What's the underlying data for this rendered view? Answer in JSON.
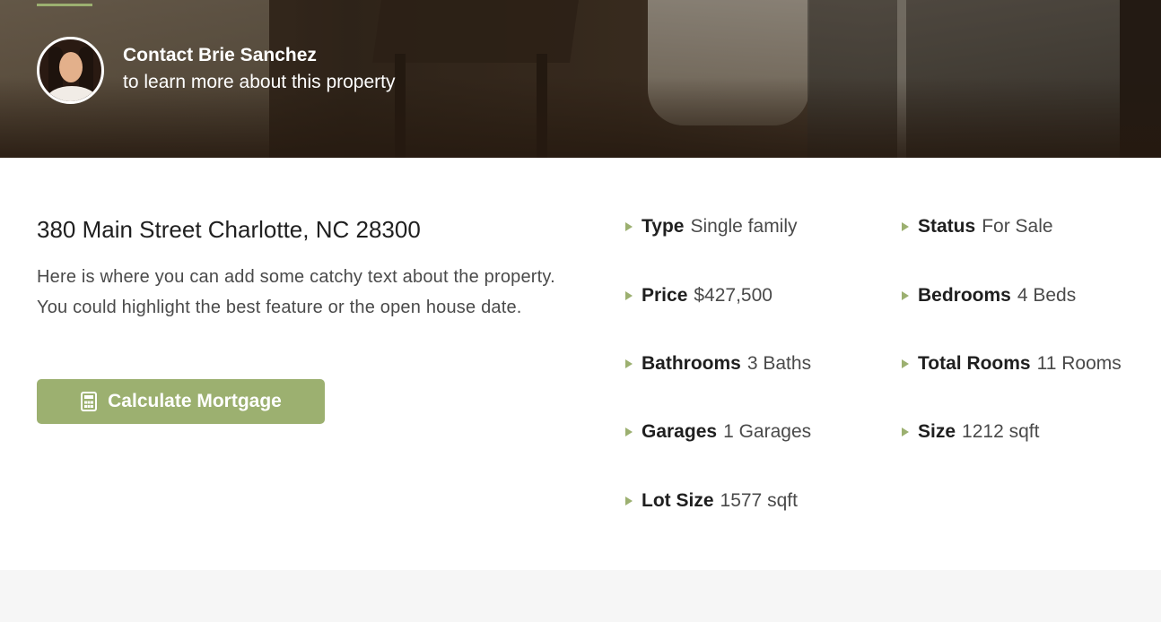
{
  "contact": {
    "name": "Contact Brie Sanchez",
    "subtitle": "to learn more about this property"
  },
  "property": {
    "address": "380 Main Street Charlotte, NC 28300",
    "description": "Here is where you can add some catchy text about the property. You could highlight the best feature or the open house date.",
    "mortgage_button": "Calculate Mortgage",
    "mortgage_icon": "calculator-icon",
    "features": [
      {
        "label": "Type",
        "value": "Single family"
      },
      {
        "label": "Status",
        "value": "For Sale"
      },
      {
        "label": "Price",
        "value": "$427,500"
      },
      {
        "label": "Bedrooms",
        "value": "4 Beds"
      },
      {
        "label": "Bathrooms",
        "value": "3 Baths"
      },
      {
        "label": "Total Rooms",
        "value": "11 Rooms"
      },
      {
        "label": "Garages",
        "value": "1 Garages"
      },
      {
        "label": "Size",
        "value": "1212 sqft"
      },
      {
        "label": "Lot Size",
        "value": "1577 sqft"
      }
    ]
  },
  "colors": {
    "accent": "#9cb070",
    "text": "#1f1f1f",
    "muted_text": "#4a4a4a",
    "footer_band": "#f6f6f6"
  }
}
